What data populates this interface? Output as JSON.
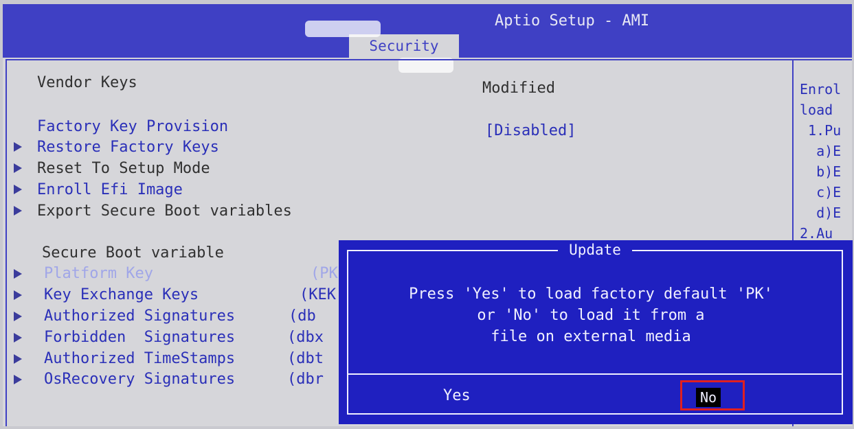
{
  "header": {
    "title": "Aptio Setup - AMI",
    "active_tab": "Security"
  },
  "settings": {
    "vendor_keys_label": "Vendor Keys",
    "vendor_keys_value": "Modified",
    "factory_key_label": "Factory Key Provision",
    "factory_key_value": "[Disabled]"
  },
  "menu_items": [
    "Restore Factory Keys",
    "Reset To Setup Mode",
    "Enroll Efi Image",
    "Export Secure Boot variables"
  ],
  "secure_boot": {
    "heading": "Secure Boot variable",
    "items": [
      {
        "label": "Platform Key",
        "tag": "(PK"
      },
      {
        "label": "Key Exchange Keys",
        "tag": "(KEK"
      },
      {
        "label": "Authorized Signatures",
        "tag": "(db"
      },
      {
        "label": "Forbidden  Signatures",
        "tag": "(dbx"
      },
      {
        "label": "Authorized TimeStamps",
        "tag": "(dbt"
      },
      {
        "label": "OsRecovery Signatures",
        "tag": "(dbr"
      }
    ]
  },
  "help_panel": [
    "Enrol",
    "load",
    " 1.Pu",
    "  a)E",
    "  b)E",
    "  c)E",
    "  d)E",
    "2.Au"
  ],
  "dialog": {
    "title": "Update",
    "lines": [
      "Press 'Yes' to load factory default 'PK'",
      "or 'No' to load it from a",
      "file on external media"
    ],
    "yes_label": "Yes",
    "no_label": "No",
    "selected": "No"
  }
}
